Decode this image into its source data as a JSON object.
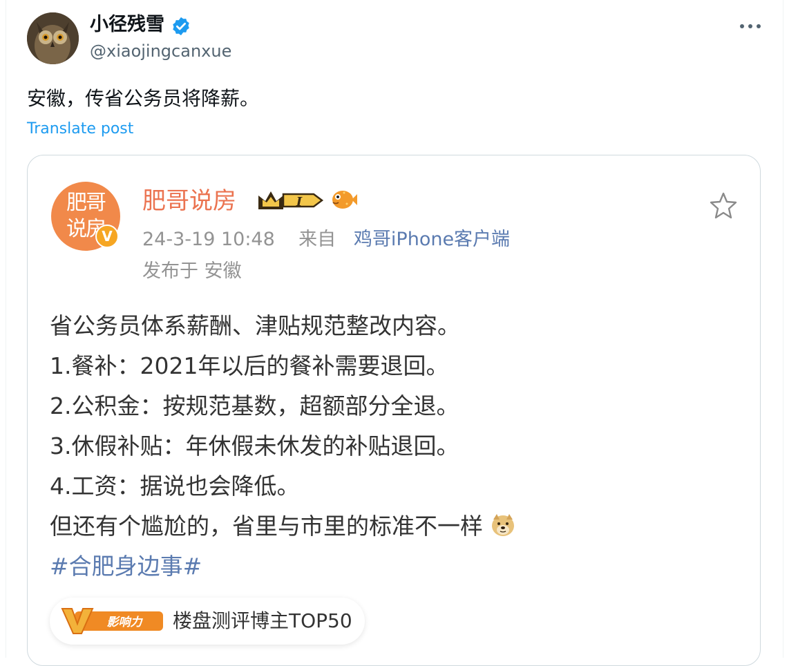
{
  "author": {
    "display_name": "小径残雪",
    "handle": "@xiaojingcanxue"
  },
  "tweet": {
    "text": "安徽，传省公务员将降薪。",
    "translate_label": "Translate post"
  },
  "embed": {
    "avatar_text_line1": "肥哥",
    "avatar_text_line2": "说房",
    "avatar_badge": "V",
    "name": "肥哥说房",
    "crown_level": "I",
    "timestamp": "24-3-19 10:48",
    "from_label": "来自",
    "source": "鸡哥iPhone客户端",
    "location": "发布于 安徽",
    "lines": [
      "省公务员体系薪酬、津贴规范整改内容。",
      "1.餐补：2021年以后的餐补需要退回。",
      "2.公积金：按规范基数，超额部分全退。",
      "3.休假补贴：年休假未休发的补贴退回。",
      "4.工资：据说也会降低。",
      "但还有个尴尬的，省里与市里的标准不一样"
    ],
    "hashtag": "#合肥身边事#",
    "pill_badge": "影响力",
    "pill_text": "楼盘测评博主TOP50"
  },
  "colors": {
    "link_blue": "#1d9bf0",
    "weibo_orange": "#eb7350",
    "weibo_link": "#5b7bb0",
    "verified": "#1d9bf0"
  }
}
